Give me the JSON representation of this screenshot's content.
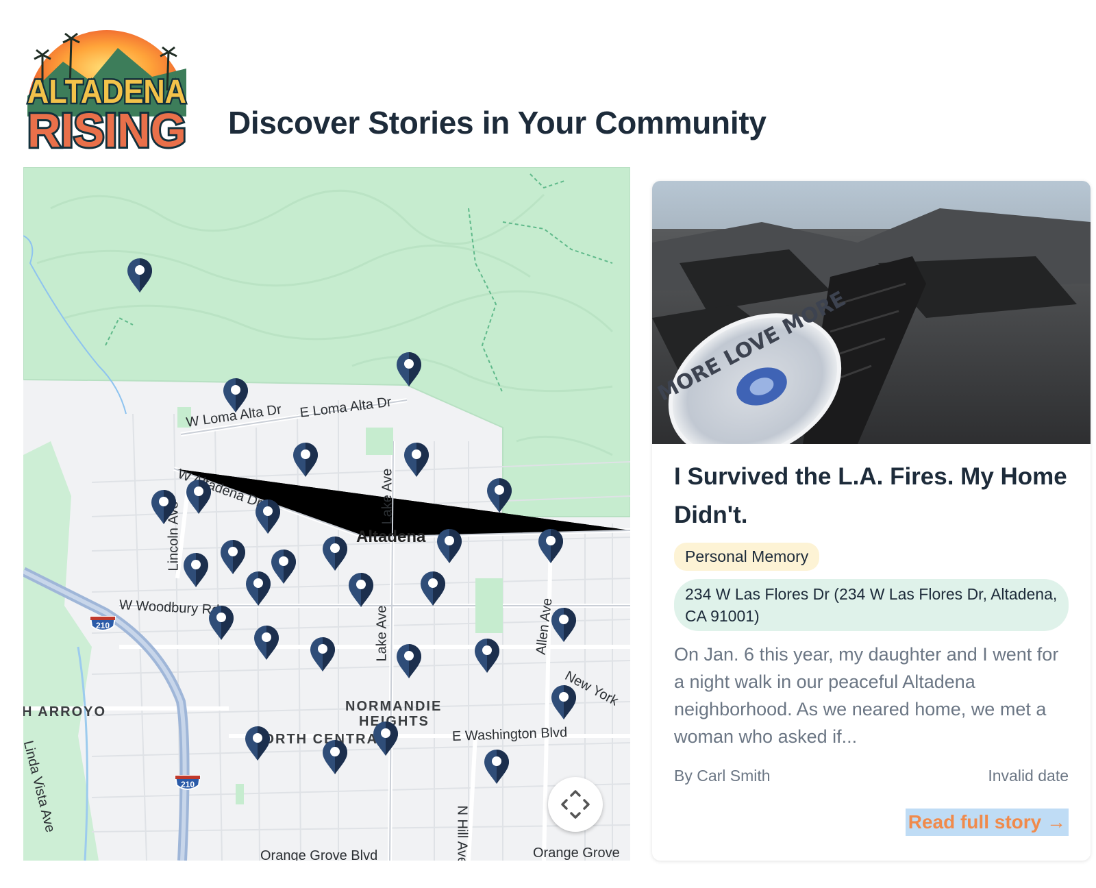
{
  "header": {
    "logo_text_line1": "ALTADENA",
    "logo_text_line2": "RISING",
    "title": "Discover Stories in Your Community"
  },
  "map": {
    "labels": {
      "w_loma_alta": "W Loma Alta Dr",
      "e_loma_alta": "E Loma Alta Dr",
      "w_altadena": "W Altadena Dr",
      "lake_ave_n": "Lake Ave",
      "lake_ave_s": "Lake Ave",
      "lincoln_ave": "Lincoln Ave",
      "altadena": "Altadena",
      "w_woodbury": "W Woodbury Rd",
      "allen_ave": "Allen Ave",
      "new_york": "New York",
      "h_arroyo": "H ARROYO",
      "normandie": "NORMANDIE",
      "heights": "HEIGHTS",
      "north_central": "NORTH CENTRAL",
      "e_washington": "E Washington Blvd",
      "linda_vista": "Linda Vista Ave",
      "n_hill": "N Hill Ave",
      "orange_grove_1": "Orange Grove Blvd",
      "orange_grove_2": "Orange Grove",
      "hwy_210_a": "210",
      "hwy_210_b": "210"
    },
    "pin_count": 32,
    "colors": {
      "park": "#c6eccf",
      "pin": "#2f4d78",
      "pin_dark": "#1c2f4d",
      "road": "#ffffff",
      "freeway": "#9fb6d8"
    }
  },
  "story_card": {
    "title": "I Survived the L.A. Fires. My Home Didn't.",
    "category": "Personal Memory",
    "address": "234 W Las Flores Dr (234 W Las Flores Dr, Altadena, CA 91001)",
    "excerpt": "On Jan. 6 this year, my daughter and I went for a night walk in our peaceful Altadena neighborhood. As we neared home, we met a woman who asked if...",
    "author": "By Carl Smith",
    "date": "Invalid date",
    "read_more": "Read full story →",
    "photo_text": "MORE LOVE MORE"
  }
}
